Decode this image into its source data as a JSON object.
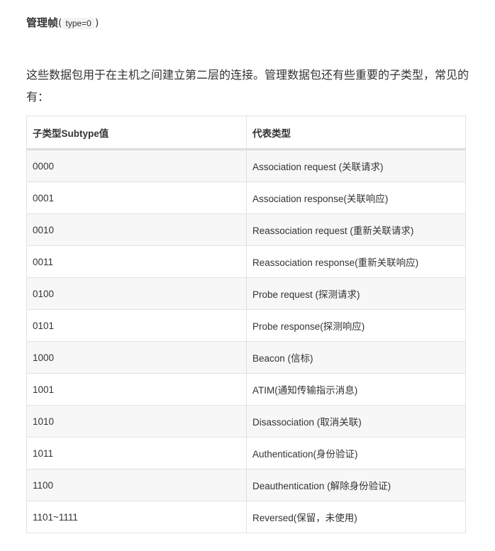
{
  "heading": {
    "title": "管理帧",
    "open_paren": "(",
    "code": "type=0",
    "close_paren": ")"
  },
  "paragraph": "这些数据包用于在主机之间建立第二层的连接。管理数据包还有些重要的子类型，常见的有：",
  "table": {
    "headers": [
      "子类型Subtype值",
      "代表类型"
    ],
    "rows": [
      [
        "0000",
        "Association request (关联请求)"
      ],
      [
        "0001",
        "Association response(关联响应)"
      ],
      [
        "0010",
        "Reassociation request (重新关联请求)"
      ],
      [
        "0011",
        "Reassociation response(重新关联响应)"
      ],
      [
        "0100",
        "Probe request (探测请求)"
      ],
      [
        "0101",
        "Probe response(探测响应)"
      ],
      [
        "1000",
        "Beacon (信标)"
      ],
      [
        "1001",
        "ATIM(通知传输指示消息)"
      ],
      [
        "1010",
        "Disassociation (取消关联)"
      ],
      [
        "1011",
        "Authentication(身份验证)"
      ],
      [
        "1100",
        "Deauthentication (解除身份验证)"
      ],
      [
        "1101~1111",
        "Reversed(保留，未使用)"
      ]
    ]
  }
}
